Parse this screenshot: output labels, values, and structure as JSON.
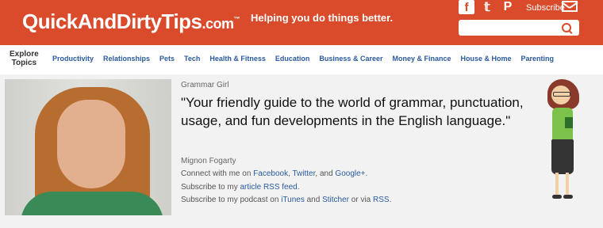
{
  "header": {
    "logo_main": "QuickAnd",
    "logo_and": "",
    "logo_dirty": "DirtyTips",
    "logo_com": ".com",
    "logo_tm": "™",
    "tagline": "Helping you do things better.",
    "subscribe_label": "Subscribe",
    "social": {
      "facebook": "f",
      "twitter": "𝕥",
      "pinterest": "P"
    }
  },
  "nav": {
    "explore_line1": "Explore",
    "explore_line2": "Topics",
    "items": [
      "Productivity",
      "Relationships",
      "Pets",
      "Tech",
      "Health & Fitness",
      "Education",
      "Business & Career",
      "Money & Finance",
      "House & Home",
      "Parenting"
    ]
  },
  "profile": {
    "blog_name": "Grammar Girl",
    "quote": "\"Your friendly guide to the world of grammar, punctuation, usage, and fun developments in the English language.\"",
    "author": "Mignon Fogarty",
    "connect_prefix": "Connect with me on ",
    "facebook": "Facebook",
    "comma1": ", ",
    "twitter": "Twitter",
    "and1": ", and ",
    "google": "Google+",
    "period1": ".",
    "rss_prefix": "Subscribe to my ",
    "article_rss": "article RSS feed",
    "period2": ".",
    "podcast_prefix": "Subscribe to my podcast on ",
    "itunes": "iTunes",
    "and2": " and ",
    "stitcher": "Stitcher",
    "or_via": " or via ",
    "rss": "RSS",
    "period3": "."
  },
  "colors": {
    "brand": "#d94b2b",
    "link": "#2a5a9e"
  }
}
